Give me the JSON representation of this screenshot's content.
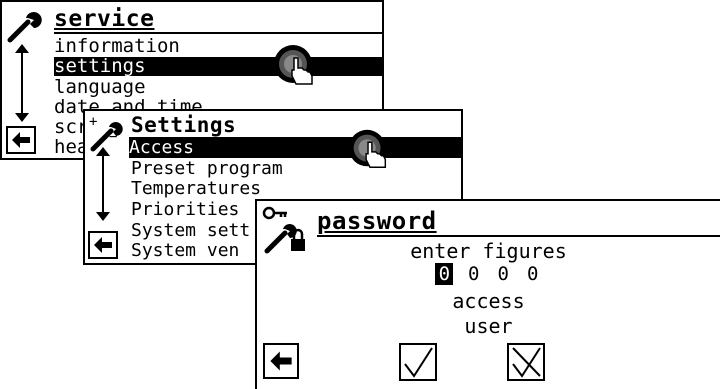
{
  "screen1": {
    "title": "service",
    "items": [
      "information",
      "settings",
      "language",
      "date and time",
      "scr",
      "hea"
    ],
    "selected": 1
  },
  "screen2": {
    "title": "Settings",
    "items": [
      "Access",
      "Preset program",
      "Temperatures",
      "Priorities",
      "System sett",
      "System ven"
    ],
    "selected": 0
  },
  "screen3": {
    "title": "password",
    "prompt": "enter figures",
    "digits": [
      "0",
      "0",
      "0",
      "0"
    ],
    "active_digit": 0,
    "access_label": "access",
    "access_value": "user"
  },
  "icons": {
    "back": "back-arrow-icon",
    "confirm": "checkmark-icon",
    "cancel": "cross-icon",
    "knob": "rotary-knob-hand-icon",
    "wrench": "wrench-icon",
    "key_lock": "key-lock-wrench-icon"
  }
}
